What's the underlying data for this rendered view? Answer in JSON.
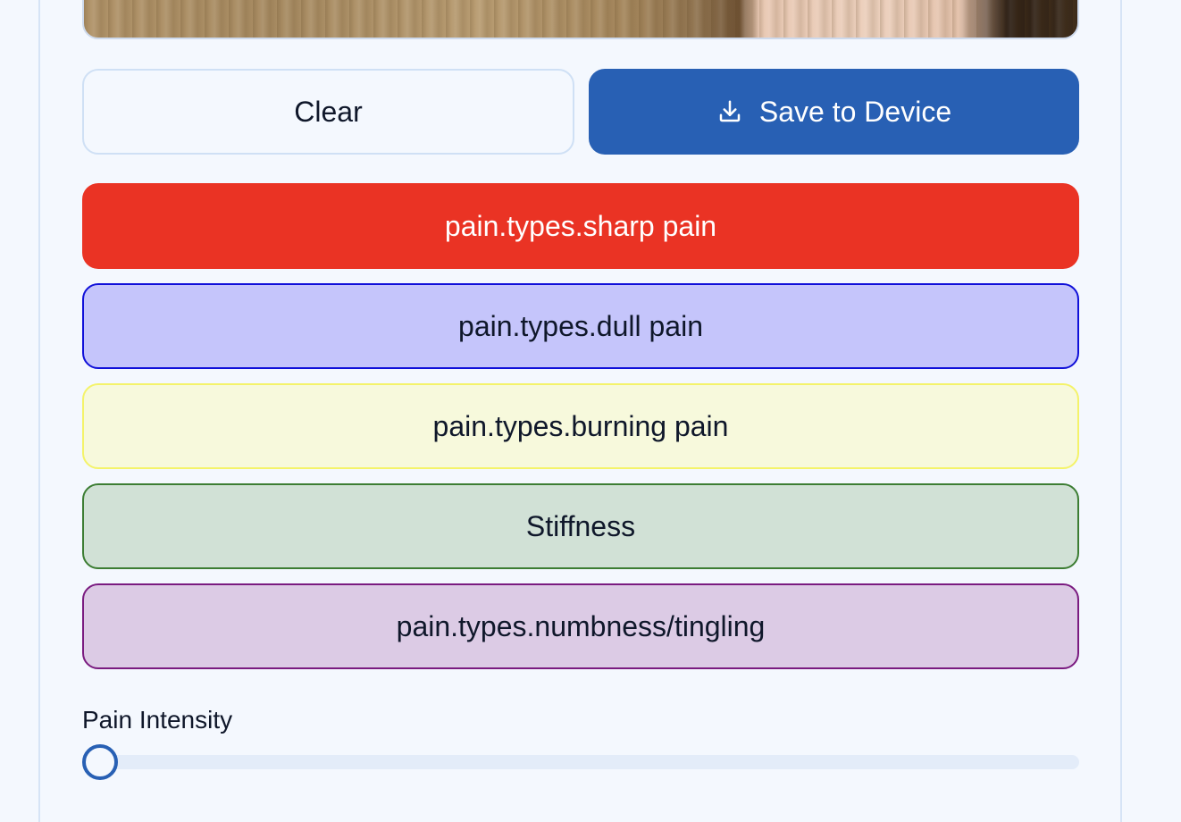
{
  "actions": {
    "clear_label": "Clear",
    "save_label": "Save to Device",
    "save_icon": "download-icon"
  },
  "pain_types": [
    {
      "label": "pain.types.sharp pain",
      "color": "#ea3324"
    },
    {
      "label": "pain.types.dull pain",
      "color": "#1010d9"
    },
    {
      "label": "pain.types.burning pain",
      "color": "#f4f36a"
    },
    {
      "label": "Stiffness",
      "color": "#3c7d33"
    },
    {
      "label": "pain.types.numbness/tingling",
      "color": "#7a1b80"
    }
  ],
  "intensity": {
    "label": "Pain Intensity",
    "value_fraction": 0.0
  },
  "colors": {
    "accent": "#2860b4",
    "background": "#f4f8fe"
  }
}
